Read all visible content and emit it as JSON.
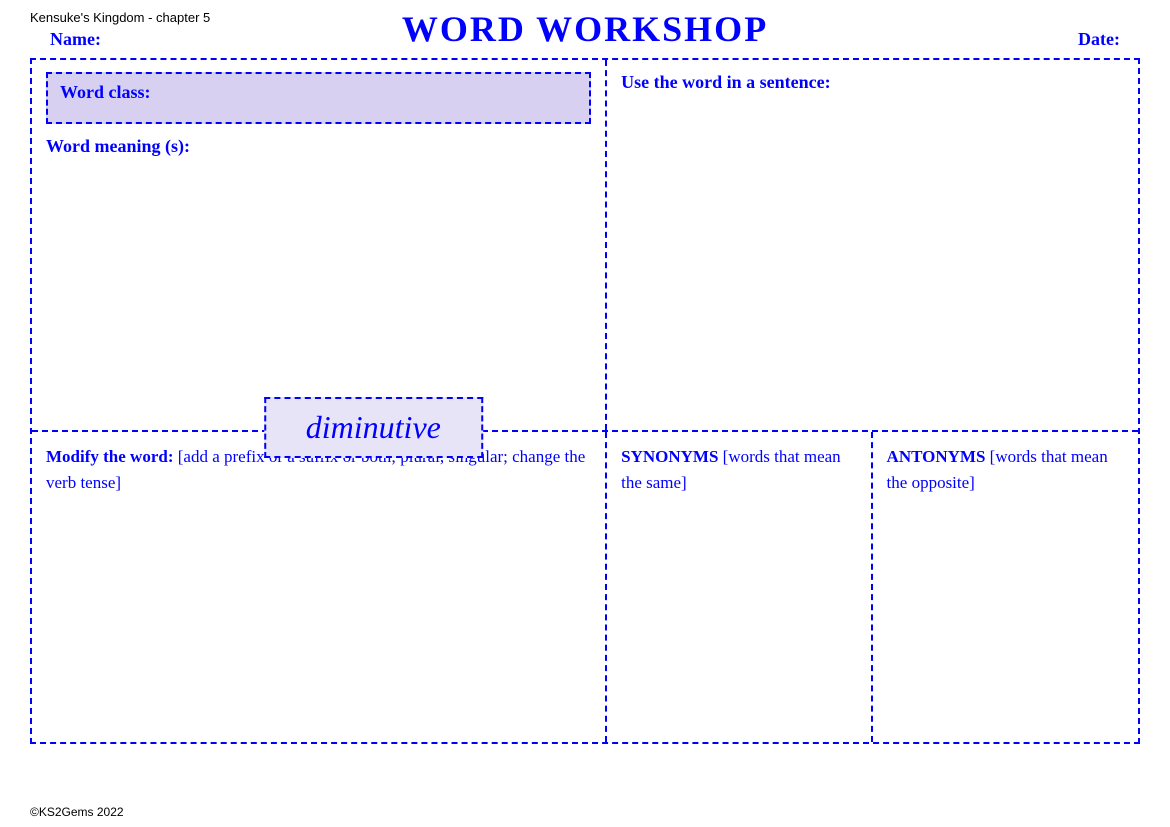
{
  "page": {
    "subtitle": "Kensuke's Kingdom - chapter 5",
    "main_title": "WORD WORKSHOP",
    "name_label": "Name:",
    "date_label": "Date:",
    "word_class_label": "Word class:",
    "word_meaning_label": "Word meaning (s):",
    "use_in_sentence_label": "Use the word in a sentence:",
    "center_word": "diminutive",
    "modify_label_strong": "Modify the word:",
    "modify_label_rest": " [add a prefix or a suffix or both; plural, singular; change the verb tense]",
    "synonyms_label_strong": "SYNONYMS",
    "synonyms_label_rest": " [words that mean the same]",
    "antonyms_label_strong": "ANTONYMS",
    "antonyms_label_rest": " [words that mean the opposite]",
    "footer": "©KS2Gems 2022"
  }
}
